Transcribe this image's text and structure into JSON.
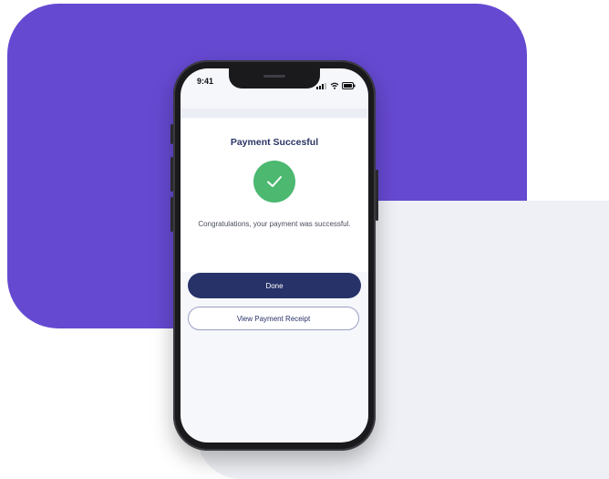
{
  "status_bar": {
    "time": "9:41",
    "icons": [
      "signal-icon",
      "wifi-icon",
      "battery-icon"
    ]
  },
  "payment": {
    "title": "Payment Succesful",
    "message": "Congratulations, your payment was successful.",
    "icon": "checkmark-icon"
  },
  "actions": {
    "done_label": "Done",
    "receipt_label": "View Payment Receipt"
  },
  "colors": {
    "purple_background": "#6649d1",
    "grey_background": "#eef0f5",
    "success_green": "#4cb870",
    "primary_navy": "#273269",
    "title_text": "#2b3566"
  }
}
